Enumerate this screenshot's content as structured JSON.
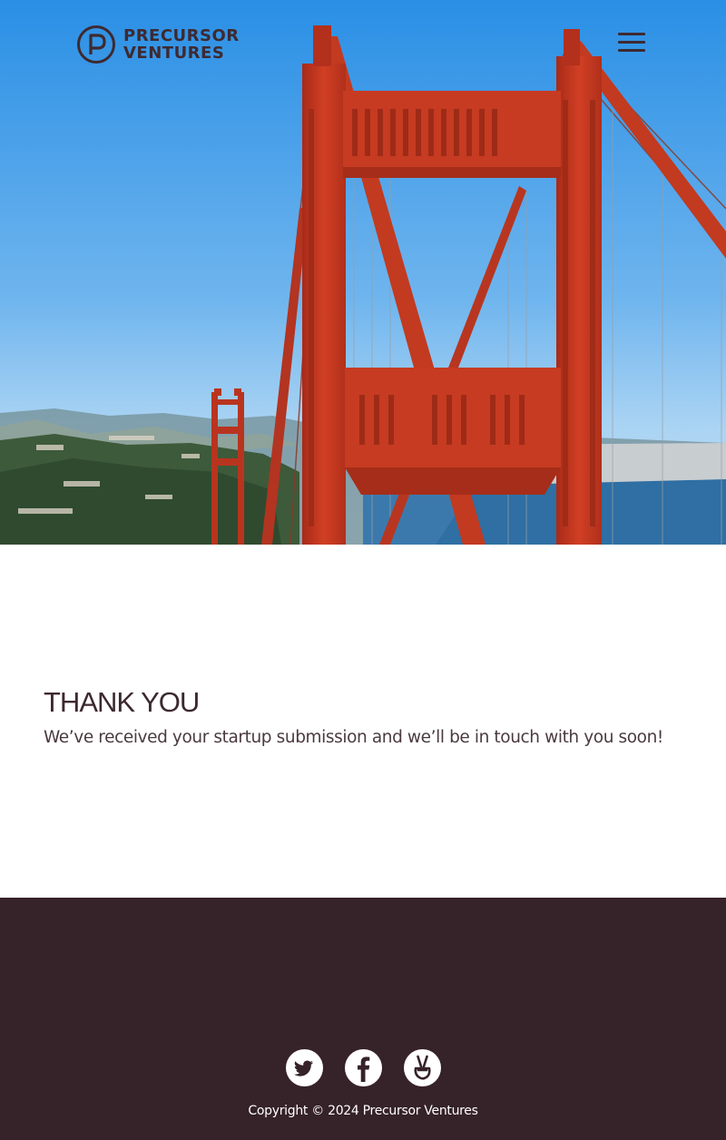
{
  "header": {
    "logo_line1": "PRECURSOR",
    "logo_line2": "VENTURES",
    "menu_icon": "hamburger-menu-icon"
  },
  "hero": {
    "image": "golden-gate-bridge-photo",
    "colors": {
      "sky_top": "#2b90e4",
      "sky_bottom": "#9fcdf1",
      "bridge": "#c5351f",
      "water": "#2f6fa3"
    }
  },
  "main": {
    "heading": "THANK YOU",
    "message": "We’ve received your startup submission and we’ll be in touch with you soon!"
  },
  "footer": {
    "social": [
      {
        "name": "twitter",
        "icon": "twitter-icon"
      },
      {
        "name": "facebook",
        "icon": "facebook-icon"
      },
      {
        "name": "angellist",
        "icon": "angellist-icon"
      }
    ],
    "copyright": "Copyright © 2024 Precursor Ventures"
  },
  "colors": {
    "brand_dark": "#3e2a31",
    "footer_bg": "#362229",
    "text": "#4a3a3f"
  }
}
